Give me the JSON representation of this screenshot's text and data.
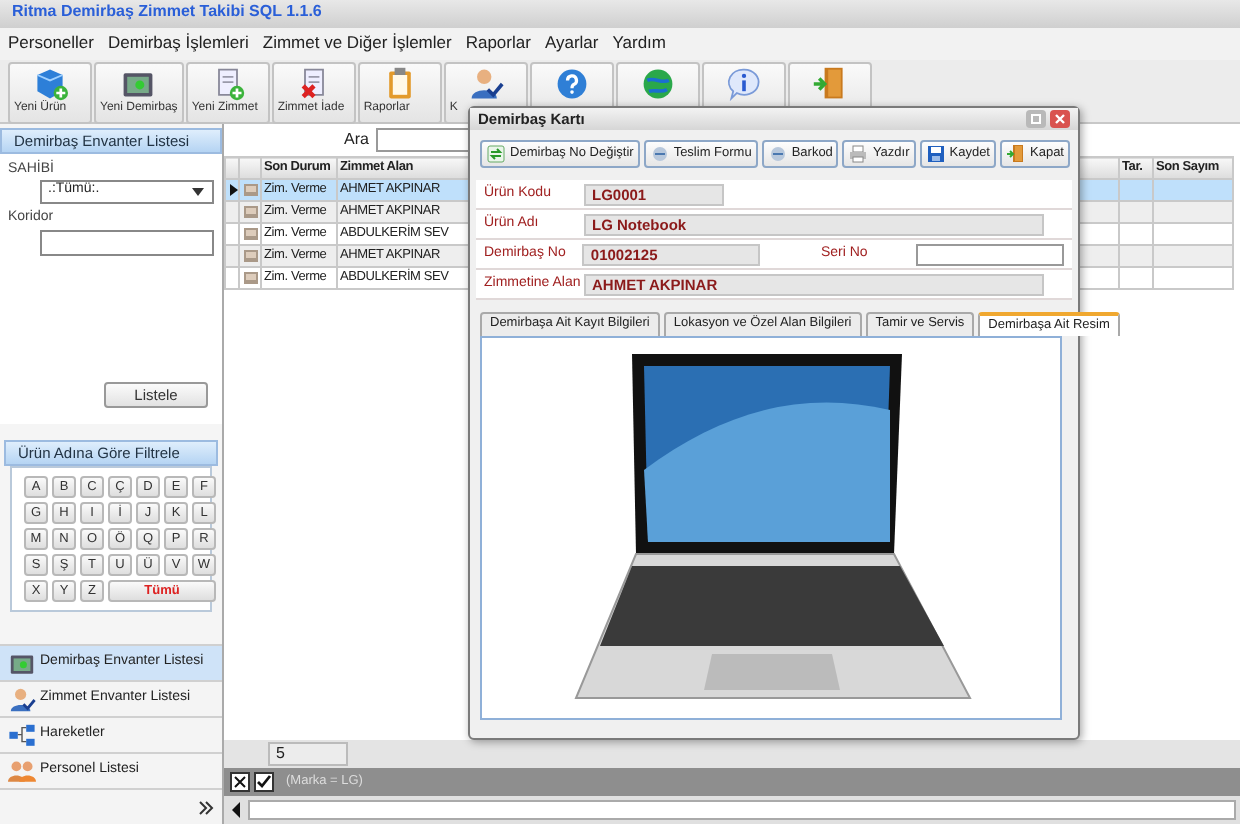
{
  "window": {
    "title": "Ritma Demirbaş Zimmet Takibi SQL  1.1.6"
  },
  "menu": [
    "Personeller",
    "Demirbaş İşlemleri",
    "Zimmet ve Diğer İşlemler",
    "Raporlar",
    "Ayarlar",
    "Yardım"
  ],
  "toolbar": [
    {
      "kind": "cube",
      "label": "Yeni Ürün"
    },
    {
      "kind": "safe",
      "label": "Yeni Demirbaş"
    },
    {
      "kind": "scroll-plus",
      "label": "Yeni Zimmet"
    },
    {
      "kind": "scroll-x",
      "label": "Zimmet İade"
    },
    {
      "kind": "clipboard",
      "label": "Raporlar"
    },
    {
      "kind": "person",
      "label": "K"
    },
    {
      "kind": "help"
    },
    {
      "kind": "globe"
    },
    {
      "kind": "info"
    },
    {
      "kind": "door"
    }
  ],
  "left_panel": {
    "header": "Demirbaş Envanter Listesi",
    "owner_label": "SAHİBİ",
    "owner_value": ".:Tümü:.",
    "corridor_label": "Koridor",
    "list_button": "Listele",
    "filter_header": "Ürün Adına Göre Filtrele",
    "letters": [
      "A",
      "B",
      "C",
      "Ç",
      "D",
      "E",
      "F",
      "G",
      "H",
      "I",
      "İ",
      "J",
      "K",
      "L",
      "M",
      "N",
      "O",
      "Ö",
      "Q",
      "P",
      "R",
      "S",
      "Ş",
      "T",
      "U",
      "Ü",
      "V",
      "W",
      "X",
      "Y",
      "Z"
    ],
    "all_button": "Tümü"
  },
  "navigation": [
    {
      "kind": "safe",
      "label": "Demirbaş Envanter Listesi",
      "selected": true
    },
    {
      "kind": "person",
      "label": "Zimmet Envanter Listesi",
      "selected": false
    },
    {
      "kind": "network",
      "label": "Hareketler",
      "selected": false
    },
    {
      "kind": "people",
      "label": "Personel Listesi",
      "selected": false
    }
  ],
  "grid": {
    "search_label": "Ara",
    "columns": [
      "Son Durum",
      "Zimmet Alan",
      "Tar.",
      "Son Sayım"
    ],
    "rows": [
      {
        "status": "Zim. Verme",
        "assignee": "AHMET AKPINAR",
        "selected": true
      },
      {
        "status": "Zim. Verme",
        "assignee": "AHMET AKPINAR",
        "selected": false
      },
      {
        "status": "Zim. Verme",
        "assignee": "ABDULKERİM SEV",
        "selected": false
      },
      {
        "status": "Zim. Verme",
        "assignee": "AHMET AKPINAR",
        "selected": false
      },
      {
        "status": "Zim. Verme",
        "assignee": "ABDULKERİM SEV",
        "selected": false
      }
    ],
    "row_count": "5",
    "filter_enabled": true,
    "filter": "(Marka = LG)"
  },
  "dialog": {
    "title": "Demirbaş Kartı",
    "buttons": [
      {
        "kind": "swap",
        "label": "Demirbaş No Değiştir"
      },
      {
        "kind": "form",
        "label": "Teslim Formu"
      },
      {
        "kind": "form",
        "label": "Barkod"
      },
      {
        "kind": "printer",
        "label": "Yazdır"
      },
      {
        "kind": "save",
        "label": "Kaydet"
      },
      {
        "kind": "door",
        "label": "Kapat"
      }
    ],
    "fields": {
      "code_label": "Ürün Kodu",
      "code": "LG0001",
      "name_label": "Ürün Adı",
      "name": "LG Notebook",
      "inventory_no_label": "Demirbaş No",
      "inventory_no": "01002125",
      "serial_label": "Seri No",
      "assignee_label": "Zimmetine Alan",
      "assignee": "AHMET AKPINAR"
    },
    "tabs": [
      {
        "label": "Demirbaşa Ait Kayıt Bilgileri",
        "selected": false
      },
      {
        "label": "Lokasyon ve Özel Alan Bilgileri",
        "selected": false
      },
      {
        "label": "Tamir ve Servis",
        "selected": false
      },
      {
        "label": "Demirbaşa Ait Resim",
        "selected": true
      }
    ]
  }
}
